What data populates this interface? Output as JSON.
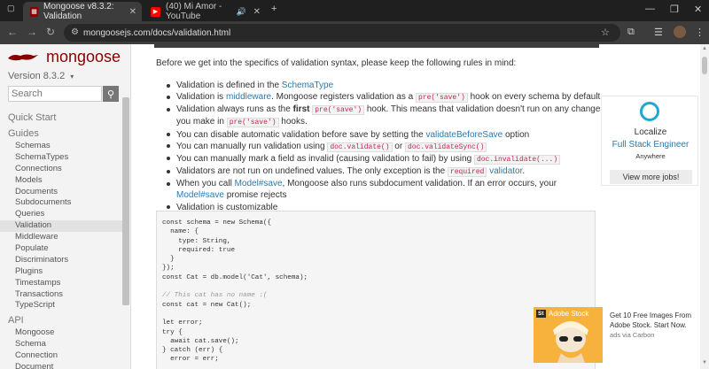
{
  "browser": {
    "tabs": [
      {
        "title": "Mongoose v8.3.2: Validation",
        "favicon": "mongoose-favicon",
        "active": true
      },
      {
        "title": "(40) Mi Amor - YouTube",
        "favicon": "youtube-favicon",
        "active": false
      }
    ],
    "url": "mongoosejs.com/docs/validation.html",
    "new_tab": "+",
    "close": "✕"
  },
  "sidebar": {
    "brand": "mongoose",
    "version": "Version 8.3.2",
    "version_caret": "▾",
    "search_placeholder": "Search",
    "sections": [
      {
        "label": "Quick Start",
        "items": []
      },
      {
        "label": "Guides",
        "items": [
          "Schemas",
          "SchemaTypes",
          "Connections",
          "Models",
          "Documents",
          "Subdocuments",
          "Queries",
          "Validation",
          "Middleware",
          "Populate",
          "Discriminators",
          "Plugins",
          "Timestamps",
          "Transactions",
          "TypeScript"
        ]
      },
      {
        "label": "API",
        "items": [
          "Mongoose",
          "Schema",
          "Connection",
          "Document"
        ]
      }
    ],
    "active_item": "Validation"
  },
  "content": {
    "intro": "Before we get into the specifics of validation syntax, please keep the following rules in mind:",
    "rules": [
      {
        "parts": [
          {
            "t": "Validation is defined in the "
          },
          {
            "t": "SchemaType",
            "link": true
          }
        ]
      },
      {
        "parts": [
          {
            "t": "Validation is "
          },
          {
            "t": "middleware",
            "link": true
          },
          {
            "t": ". Mongoose registers validation as a "
          },
          {
            "t": "pre('save')",
            "code": true
          },
          {
            "t": " hook on every schema by default."
          }
        ]
      },
      {
        "parts": [
          {
            "t": "Validation always runs as the "
          },
          {
            "t": "first",
            "bold": true
          },
          {
            "t": " "
          },
          {
            "t": "pre('save')",
            "code": true
          },
          {
            "t": " hook. This means that validation doesn't run on any changes you make in "
          },
          {
            "t": "pre('save')",
            "code": true
          },
          {
            "t": " hooks."
          }
        ]
      },
      {
        "parts": [
          {
            "t": "You can disable automatic validation before save by setting the "
          },
          {
            "t": "validateBeforeSave",
            "link": true
          },
          {
            "t": " option"
          }
        ]
      },
      {
        "parts": [
          {
            "t": "You can manually run validation using "
          },
          {
            "t": "doc.validate()",
            "code": true
          },
          {
            "t": " or "
          },
          {
            "t": "doc.validateSync()",
            "code": true
          }
        ]
      },
      {
        "parts": [
          {
            "t": "You can manually mark a field as invalid (causing validation to fail) by using "
          },
          {
            "t": "doc.invalidate(...)",
            "code": true
          }
        ]
      },
      {
        "parts": [
          {
            "t": "Validators are not run on undefined values. The only exception is the "
          },
          {
            "t": "required",
            "code": true
          },
          {
            "t": " "
          },
          {
            "t": "validator",
            "link": true
          },
          {
            "t": "."
          }
        ]
      },
      {
        "parts": [
          {
            "t": "When you call "
          },
          {
            "t": "Model#save",
            "link": true
          },
          {
            "t": ", Mongoose also runs subdocument validation. If an error occurs, your "
          },
          {
            "t": "Model#save",
            "link": true
          },
          {
            "t": " promise rejects"
          }
        ]
      },
      {
        "parts": [
          {
            "t": "Validation is customizable"
          }
        ]
      }
    ],
    "code_lines": [
      "const schema = new Schema({",
      "  name: {",
      "    type: String,",
      "    required: true",
      "  }",
      "});",
      "const Cat = db.model('Cat', schema);",
      "",
      "// This cat has no name :(",
      "const cat = new Cat();",
      "",
      "let error;",
      "try {",
      "  await cat.save();",
      "} catch (err) {",
      "  error = err;"
    ]
  },
  "ads": {
    "localize": {
      "company": "Localize",
      "role": "Full Stack Engineer",
      "location": "Anywhere",
      "button": "View more jobs!"
    },
    "carbon": {
      "badge": "St",
      "brand": "Adobe Stock",
      "text": "Get 10 Free Images From Adobe Stock. Start Now.",
      "via": "ads via Carbon"
    }
  },
  "colors": {
    "brand": "#880000",
    "link": "#2a7ab0",
    "code_text": "#c7254e",
    "ad_accent": "#1fa7d8"
  }
}
